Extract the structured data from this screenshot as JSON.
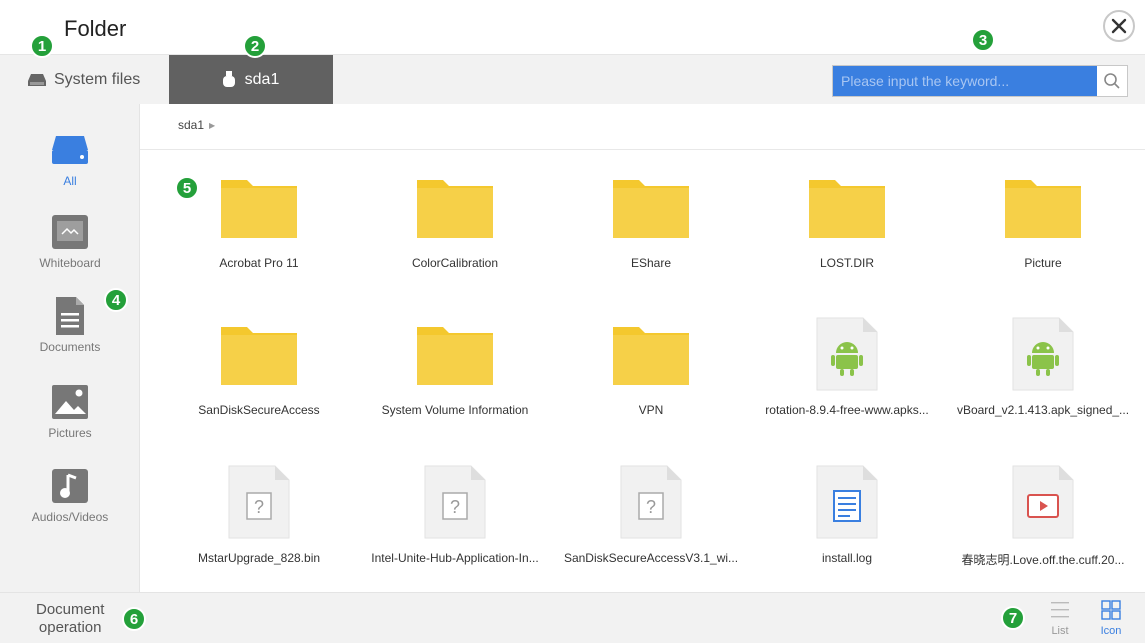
{
  "header": {
    "title": "Folder"
  },
  "tabs": [
    {
      "label": "System files",
      "icon": "hard-drive-icon"
    },
    {
      "label": "sda1",
      "icon": "usb-icon"
    }
  ],
  "search": {
    "placeholder": "Please input the keyword..."
  },
  "breadcrumb": {
    "path": "sda1"
  },
  "sidebar": {
    "items": [
      {
        "label": "All",
        "icon": "drive-icon"
      },
      {
        "label": "Whiteboard",
        "icon": "whiteboard-icon"
      },
      {
        "label": "Documents",
        "icon": "document-icon"
      },
      {
        "label": "Pictures",
        "icon": "picture-icon"
      },
      {
        "label": "Audios/Videos",
        "icon": "music-icon"
      }
    ]
  },
  "files": [
    {
      "name": "Acrobat Pro 11",
      "type": "folder"
    },
    {
      "name": "ColorCalibration",
      "type": "folder"
    },
    {
      "name": "EShare",
      "type": "folder"
    },
    {
      "name": "LOST.DIR",
      "type": "folder"
    },
    {
      "name": "Picture",
      "type": "folder"
    },
    {
      "name": "SanDiskSecureAccess",
      "type": "folder"
    },
    {
      "name": "System Volume Information",
      "type": "folder"
    },
    {
      "name": "VPN",
      "type": "folder"
    },
    {
      "name": "rotation-8.9.4-free-www.apks...",
      "type": "apk"
    },
    {
      "name": "vBoard_v2.1.413.apk_signed_...",
      "type": "apk"
    },
    {
      "name": "MstarUpgrade_828.bin",
      "type": "unknown"
    },
    {
      "name": "Intel-Unite-Hub-Application-In...",
      "type": "unknown"
    },
    {
      "name": "SanDiskSecureAccessV3.1_wi...",
      "type": "unknown"
    },
    {
      "name": "install.log",
      "type": "text"
    },
    {
      "name": "春晓志明.Love.off.the.cuff.20...",
      "type": "video"
    }
  ],
  "footer": {
    "document_operation": "Document\noperation",
    "list_label": "List",
    "icon_label": "Icon"
  },
  "badges": [
    "1",
    "2",
    "3",
    "4",
    "5",
    "6",
    "7"
  ],
  "colors": {
    "accent": "#3a7fe0",
    "folder": "#f4c82e",
    "active_tab": "#616161",
    "badge": "#24a03a"
  }
}
